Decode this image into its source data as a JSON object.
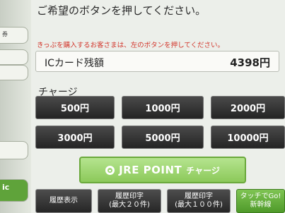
{
  "header": {
    "title": "ご希望のボタンを押してください。"
  },
  "notice": "きっぷを購入するお客さまは、左のボタンを押してください。",
  "balance": {
    "label": "ICカード残額",
    "value": "4398円"
  },
  "charge": {
    "label": "チャージ",
    "amounts": [
      "500円",
      "1000円",
      "2000円",
      "3000円",
      "5000円",
      "10000円"
    ]
  },
  "jre_point": {
    "main": "JRE POINT",
    "sub": "チャージ"
  },
  "bottom": {
    "history": "履歴表示",
    "print20_line1": "履歴印字",
    "print20_line2": "(最大２０件)",
    "print100_line1": "履歴印字",
    "print100_line2": "(最大１００件)",
    "touchgo_line1": "タッチでGo!",
    "touchgo_line2": "新幹線"
  },
  "sidebar": {
    "tab_ic": "ic",
    "tab_ken": "券"
  },
  "colors": {
    "notice_red": "#d2342a",
    "accent_green": "#8cc95a",
    "button_dark": "#2e2e2e"
  }
}
